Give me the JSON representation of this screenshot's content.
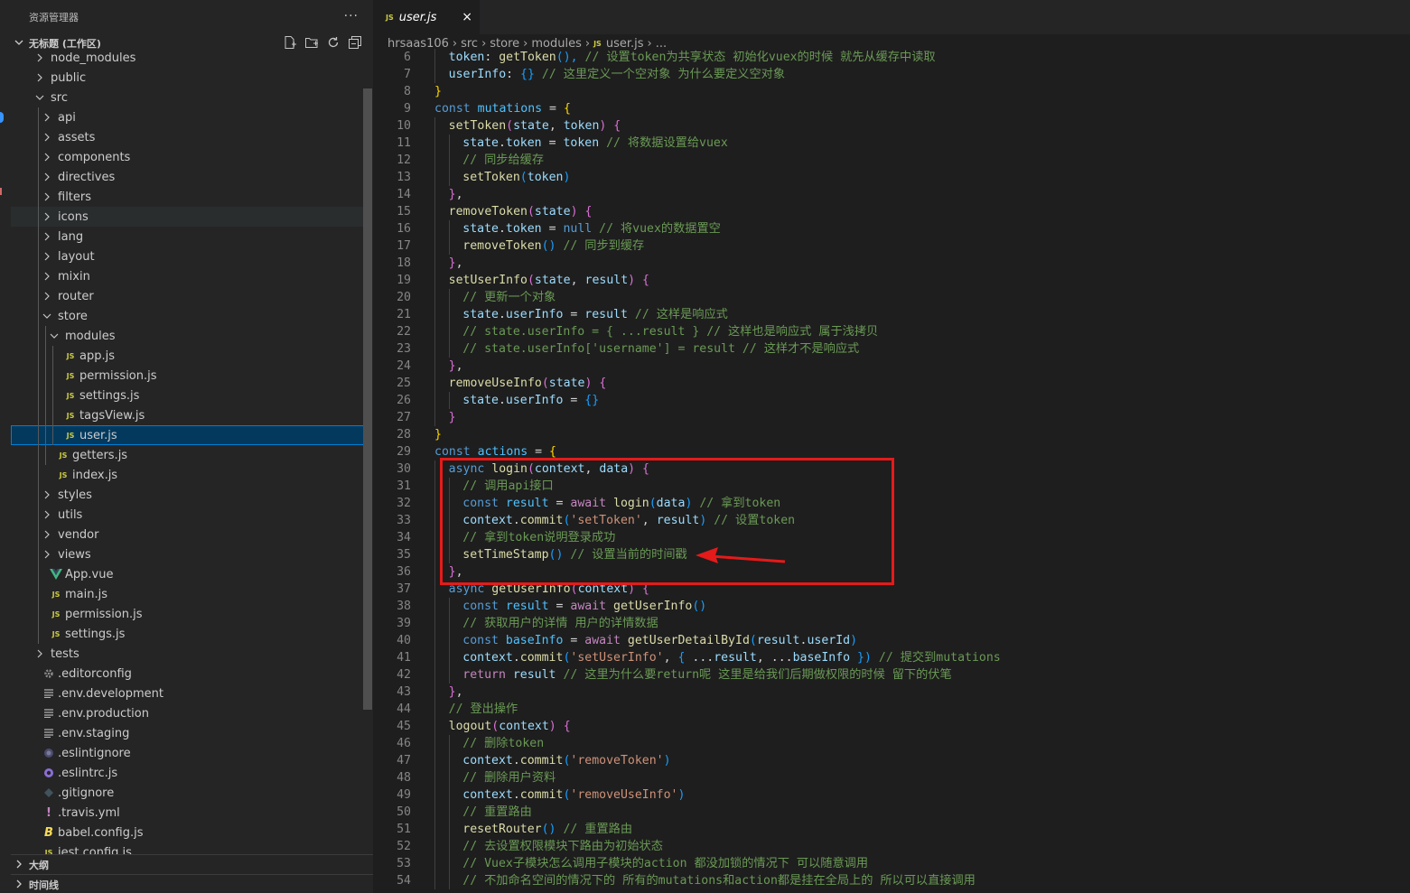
{
  "sidebar": {
    "title": "资源管理器",
    "more": "···",
    "workspace": "无标题 (工作区)",
    "tree": [
      {
        "label": "node_modules",
        "depth": 1,
        "kind": "folder",
        "open": false
      },
      {
        "label": "public",
        "depth": 1,
        "kind": "folder",
        "open": false
      },
      {
        "label": "src",
        "depth": 1,
        "kind": "folder",
        "open": true
      },
      {
        "label": "api",
        "depth": 2,
        "kind": "folder",
        "open": false
      },
      {
        "label": "assets",
        "depth": 2,
        "kind": "folder",
        "open": false
      },
      {
        "label": "components",
        "depth": 2,
        "kind": "folder",
        "open": false
      },
      {
        "label": "directives",
        "depth": 2,
        "kind": "folder",
        "open": false
      },
      {
        "label": "filters",
        "depth": 2,
        "kind": "folder",
        "open": false
      },
      {
        "label": "icons",
        "depth": 2,
        "kind": "folder",
        "open": false,
        "hover": true
      },
      {
        "label": "lang",
        "depth": 2,
        "kind": "folder",
        "open": false
      },
      {
        "label": "layout",
        "depth": 2,
        "kind": "folder",
        "open": false
      },
      {
        "label": "mixin",
        "depth": 2,
        "kind": "folder",
        "open": false
      },
      {
        "label": "router",
        "depth": 2,
        "kind": "folder",
        "open": false
      },
      {
        "label": "store",
        "depth": 2,
        "kind": "folder",
        "open": true
      },
      {
        "label": "modules",
        "depth": 3,
        "kind": "folder",
        "open": true
      },
      {
        "label": "app.js",
        "depth": 4,
        "kind": "js"
      },
      {
        "label": "permission.js",
        "depth": 4,
        "kind": "js"
      },
      {
        "label": "settings.js",
        "depth": 4,
        "kind": "js"
      },
      {
        "label": "tagsView.js",
        "depth": 4,
        "kind": "js"
      },
      {
        "label": "user.js",
        "depth": 4,
        "kind": "js",
        "selected": true
      },
      {
        "label": "getters.js",
        "depth": 3,
        "kind": "js"
      },
      {
        "label": "index.js",
        "depth": 3,
        "kind": "js"
      },
      {
        "label": "styles",
        "depth": 2,
        "kind": "folder",
        "open": false
      },
      {
        "label": "utils",
        "depth": 2,
        "kind": "folder",
        "open": false
      },
      {
        "label": "vendor",
        "depth": 2,
        "kind": "folder",
        "open": false
      },
      {
        "label": "views",
        "depth": 2,
        "kind": "folder",
        "open": false
      },
      {
        "label": "App.vue",
        "depth": 2,
        "kind": "vue"
      },
      {
        "label": "main.js",
        "depth": 2,
        "kind": "js"
      },
      {
        "label": "permission.js",
        "depth": 2,
        "kind": "js"
      },
      {
        "label": "settings.js",
        "depth": 2,
        "kind": "js"
      },
      {
        "label": "tests",
        "depth": 1,
        "kind": "folder",
        "open": false
      },
      {
        "label": ".editorconfig",
        "depth": 1,
        "kind": "gear"
      },
      {
        "label": ".env.development",
        "depth": 1,
        "kind": "lines"
      },
      {
        "label": ".env.production",
        "depth": 1,
        "kind": "lines"
      },
      {
        "label": ".env.staging",
        "depth": 1,
        "kind": "lines"
      },
      {
        "label": ".eslintignore",
        "depth": 1,
        "kind": "circle-grey"
      },
      {
        "label": ".eslintrc.js",
        "depth": 1,
        "kind": "circle-purple"
      },
      {
        "label": ".gitignore",
        "depth": 1,
        "kind": "diamond"
      },
      {
        "label": ".travis.yml",
        "depth": 1,
        "kind": "excl"
      },
      {
        "label": "babel.config.js",
        "depth": 1,
        "kind": "babel"
      },
      {
        "label": "jest.config.js",
        "depth": 1,
        "kind": "js"
      }
    ],
    "panels": [
      "大纲",
      "时间线"
    ]
  },
  "tab": {
    "label": "user.js",
    "close": "×",
    "badge": "JS"
  },
  "breadcrumb": [
    "hrsaas106",
    "src",
    "store",
    "modules",
    "user.js",
    "..."
  ],
  "code": [
    {
      "n": "6",
      "i": 1,
      "t": [
        [
          "token",
          "p"
        ],
        [
          ": ",
          "w"
        ],
        [
          "getToken",
          "f"
        ],
        [
          "(), ",
          "b"
        ],
        [
          "// 设置token为共享状态 初始化vuex的时候 就先从缓存中读取",
          "c"
        ]
      ]
    },
    {
      "n": "7",
      "i": 1,
      "t": [
        [
          "userInfo",
          "p"
        ],
        [
          ": ",
          "w"
        ],
        [
          "{}",
          "b"
        ],
        [
          " ",
          "w"
        ],
        [
          "// 这里定义一个空对象 为什么要定义空对象",
          "c"
        ]
      ]
    },
    {
      "n": "8",
      "i": 0,
      "t": [
        [
          "}",
          "y"
        ]
      ]
    },
    {
      "n": "9",
      "i": 0,
      "t": [
        [
          "const ",
          "k"
        ],
        [
          "mutations",
          "v"
        ],
        [
          " = ",
          "w"
        ],
        [
          "{",
          "y"
        ]
      ]
    },
    {
      "n": "10",
      "i": 1,
      "t": [
        [
          "setToken",
          "f"
        ],
        [
          "(",
          "p2"
        ],
        [
          "state",
          "p"
        ],
        [
          ", ",
          "w"
        ],
        [
          "token",
          "p"
        ],
        [
          ") ",
          "p2"
        ],
        [
          "{",
          "p2"
        ]
      ]
    },
    {
      "n": "11",
      "i": 2,
      "t": [
        [
          "state",
          "p"
        ],
        [
          ".",
          "w"
        ],
        [
          "token",
          "p"
        ],
        [
          " = ",
          "w"
        ],
        [
          "token",
          "p"
        ],
        [
          " ",
          "w"
        ],
        [
          "// 将数据设置给vuex",
          "c"
        ]
      ]
    },
    {
      "n": "12",
      "i": 2,
      "t": [
        [
          "// 同步给缓存",
          "c"
        ]
      ]
    },
    {
      "n": "13",
      "i": 2,
      "t": [
        [
          "setToken",
          "f"
        ],
        [
          "(",
          "b"
        ],
        [
          "token",
          "p"
        ],
        [
          ")",
          "b"
        ]
      ]
    },
    {
      "n": "14",
      "i": 1,
      "t": [
        [
          "}",
          "p2"
        ],
        [
          ",",
          "w"
        ]
      ]
    },
    {
      "n": "15",
      "i": 1,
      "t": [
        [
          "removeToken",
          "f"
        ],
        [
          "(",
          "p2"
        ],
        [
          "state",
          "p"
        ],
        [
          ") ",
          "p2"
        ],
        [
          "{",
          "p2"
        ]
      ]
    },
    {
      "n": "16",
      "i": 2,
      "t": [
        [
          "state",
          "p"
        ],
        [
          ".",
          "w"
        ],
        [
          "token",
          "p"
        ],
        [
          " = ",
          "w"
        ],
        [
          "null",
          "k"
        ],
        [
          " ",
          "w"
        ],
        [
          "// 将vuex的数据置空",
          "c"
        ]
      ]
    },
    {
      "n": "17",
      "i": 2,
      "t": [
        [
          "removeToken",
          "f"
        ],
        [
          "()",
          "b"
        ],
        [
          " ",
          "w"
        ],
        [
          "// 同步到缓存",
          "c"
        ]
      ]
    },
    {
      "n": "18",
      "i": 1,
      "t": [
        [
          "}",
          "p2"
        ],
        [
          ",",
          "w"
        ]
      ]
    },
    {
      "n": "19",
      "i": 1,
      "t": [
        [
          "setUserInfo",
          "f"
        ],
        [
          "(",
          "p2"
        ],
        [
          "state",
          "p"
        ],
        [
          ", ",
          "w"
        ],
        [
          "result",
          "p"
        ],
        [
          ") ",
          "p2"
        ],
        [
          "{",
          "p2"
        ]
      ]
    },
    {
      "n": "20",
      "i": 2,
      "t": [
        [
          "// 更新一个对象",
          "c"
        ]
      ]
    },
    {
      "n": "21",
      "i": 2,
      "t": [
        [
          "state",
          "p"
        ],
        [
          ".",
          "w"
        ],
        [
          "userInfo",
          "p"
        ],
        [
          " = ",
          "w"
        ],
        [
          "result",
          "p"
        ],
        [
          " ",
          "w"
        ],
        [
          "// 这样是响应式",
          "c"
        ]
      ]
    },
    {
      "n": "22",
      "i": 2,
      "t": [
        [
          "// state.userInfo = { ...result } // 这样也是响应式 属于浅拷贝",
          "c"
        ]
      ]
    },
    {
      "n": "23",
      "i": 2,
      "t": [
        [
          "// state.userInfo['username'] = result // 这样才不是响应式",
          "c"
        ]
      ]
    },
    {
      "n": "24",
      "i": 1,
      "t": [
        [
          "}",
          "p2"
        ],
        [
          ",",
          "w"
        ]
      ]
    },
    {
      "n": "25",
      "i": 1,
      "t": [
        [
          "removeUseInfo",
          "f"
        ],
        [
          "(",
          "p2"
        ],
        [
          "state",
          "p"
        ],
        [
          ") ",
          "p2"
        ],
        [
          "{",
          "p2"
        ]
      ]
    },
    {
      "n": "26",
      "i": 2,
      "t": [
        [
          "state",
          "p"
        ],
        [
          ".",
          "w"
        ],
        [
          "userInfo",
          "p"
        ],
        [
          " = ",
          "w"
        ],
        [
          "{}",
          "b"
        ]
      ]
    },
    {
      "n": "27",
      "i": 1,
      "t": [
        [
          "}",
          "p2"
        ]
      ]
    },
    {
      "n": "28",
      "i": 0,
      "t": [
        [
          "}",
          "y"
        ]
      ]
    },
    {
      "n": "29",
      "i": 0,
      "t": [
        [
          "const ",
          "k"
        ],
        [
          "actions",
          "v"
        ],
        [
          " = ",
          "w"
        ],
        [
          "{",
          "y"
        ]
      ]
    },
    {
      "n": "30",
      "i": 1,
      "t": [
        [
          "async ",
          "k"
        ],
        [
          "login",
          "f"
        ],
        [
          "(",
          "p2"
        ],
        [
          "context",
          "p"
        ],
        [
          ", ",
          "w"
        ],
        [
          "data",
          "p"
        ],
        [
          ") ",
          "p2"
        ],
        [
          "{",
          "p2"
        ]
      ]
    },
    {
      "n": "31",
      "i": 2,
      "t": [
        [
          "// 调用api接口",
          "c"
        ]
      ]
    },
    {
      "n": "32",
      "i": 2,
      "t": [
        [
          "const ",
          "k"
        ],
        [
          "result",
          "v"
        ],
        [
          " = ",
          "w"
        ],
        [
          "await ",
          "m"
        ],
        [
          "login",
          "f"
        ],
        [
          "(",
          "b"
        ],
        [
          "data",
          "p"
        ],
        [
          ")",
          "b"
        ],
        [
          " ",
          "w"
        ],
        [
          "// 拿到token",
          "c"
        ]
      ]
    },
    {
      "n": "33",
      "i": 2,
      "t": [
        [
          "context",
          "p"
        ],
        [
          ".",
          "w"
        ],
        [
          "commit",
          "f"
        ],
        [
          "(",
          "b"
        ],
        [
          "'setToken'",
          "s"
        ],
        [
          ", ",
          "w"
        ],
        [
          "result",
          "p"
        ],
        [
          ")",
          "b"
        ],
        [
          " ",
          "w"
        ],
        [
          "// 设置token",
          "c"
        ]
      ]
    },
    {
      "n": "34",
      "i": 2,
      "t": [
        [
          "// 拿到token说明登录成功",
          "c"
        ]
      ]
    },
    {
      "n": "35",
      "i": 2,
      "t": [
        [
          "setTimeStamp",
          "f"
        ],
        [
          "()",
          "b"
        ],
        [
          " ",
          "w"
        ],
        [
          "// 设置当前的时间戳",
          "c"
        ]
      ]
    },
    {
      "n": "36",
      "i": 1,
      "t": [
        [
          "}",
          "p2"
        ],
        [
          ",",
          "w"
        ]
      ]
    },
    {
      "n": "37",
      "i": 1,
      "t": [
        [
          "async ",
          "k"
        ],
        [
          "getUserInfo",
          "f"
        ],
        [
          "(",
          "p2"
        ],
        [
          "context",
          "p"
        ],
        [
          ") ",
          "p2"
        ],
        [
          "{",
          "p2"
        ]
      ]
    },
    {
      "n": "38",
      "i": 2,
      "t": [
        [
          "const ",
          "k"
        ],
        [
          "result",
          "v"
        ],
        [
          " = ",
          "w"
        ],
        [
          "await ",
          "m"
        ],
        [
          "getUserInfo",
          "f"
        ],
        [
          "()",
          "b"
        ]
      ]
    },
    {
      "n": "39",
      "i": 2,
      "t": [
        [
          "// 获取用户的详情 用户的详情数据",
          "c"
        ]
      ]
    },
    {
      "n": "40",
      "i": 2,
      "t": [
        [
          "const ",
          "k"
        ],
        [
          "baseInfo",
          "v"
        ],
        [
          " = ",
          "w"
        ],
        [
          "await ",
          "m"
        ],
        [
          "getUserDetailById",
          "f"
        ],
        [
          "(",
          "b"
        ],
        [
          "result",
          "p"
        ],
        [
          ".",
          "w"
        ],
        [
          "userId",
          "p"
        ],
        [
          ")",
          "b"
        ]
      ]
    },
    {
      "n": "41",
      "i": 2,
      "t": [
        [
          "context",
          "p"
        ],
        [
          ".",
          "w"
        ],
        [
          "commit",
          "f"
        ],
        [
          "(",
          "b"
        ],
        [
          "'setUserInfo'",
          "s"
        ],
        [
          ", ",
          "w"
        ],
        [
          "{ ",
          "b"
        ],
        [
          "...",
          "w"
        ],
        [
          "result",
          "p"
        ],
        [
          ", ",
          "w"
        ],
        [
          "...",
          "w"
        ],
        [
          "baseInfo",
          "p"
        ],
        [
          " })",
          "b"
        ],
        [
          " ",
          "w"
        ],
        [
          "// 提交到mutations",
          "c"
        ]
      ]
    },
    {
      "n": "42",
      "i": 2,
      "t": [
        [
          "return ",
          "m"
        ],
        [
          "result",
          "p"
        ],
        [
          " ",
          "w"
        ],
        [
          "// 这里为什么要return呢 这里是给我们后期做权限的时候 留下的伏笔",
          "c"
        ]
      ]
    },
    {
      "n": "43",
      "i": 1,
      "t": [
        [
          "}",
          "p2"
        ],
        [
          ",",
          "w"
        ]
      ]
    },
    {
      "n": "44",
      "i": 1,
      "t": [
        [
          "// 登出操作",
          "c"
        ]
      ]
    },
    {
      "n": "45",
      "i": 1,
      "t": [
        [
          "logout",
          "f"
        ],
        [
          "(",
          "p2"
        ],
        [
          "context",
          "p"
        ],
        [
          ") ",
          "p2"
        ],
        [
          "{",
          "p2"
        ]
      ]
    },
    {
      "n": "46",
      "i": 2,
      "t": [
        [
          "// 删除token",
          "c"
        ]
      ]
    },
    {
      "n": "47",
      "i": 2,
      "t": [
        [
          "context",
          "p"
        ],
        [
          ".",
          "w"
        ],
        [
          "commit",
          "f"
        ],
        [
          "(",
          "b"
        ],
        [
          "'removeToken'",
          "s"
        ],
        [
          ")",
          "b"
        ]
      ]
    },
    {
      "n": "48",
      "i": 2,
      "t": [
        [
          "// 删除用户资料",
          "c"
        ]
      ]
    },
    {
      "n": "49",
      "i": 2,
      "t": [
        [
          "context",
          "p"
        ],
        [
          ".",
          "w"
        ],
        [
          "commit",
          "f"
        ],
        [
          "(",
          "b"
        ],
        [
          "'removeUseInfo'",
          "s"
        ],
        [
          ")",
          "b"
        ]
      ]
    },
    {
      "n": "50",
      "i": 2,
      "t": [
        [
          "// 重置路由",
          "c"
        ]
      ]
    },
    {
      "n": "51",
      "i": 2,
      "t": [
        [
          "resetRouter",
          "f"
        ],
        [
          "()",
          "b"
        ],
        [
          " ",
          "w"
        ],
        [
          "// 重置路由",
          "c"
        ]
      ]
    },
    {
      "n": "52",
      "i": 2,
      "t": [
        [
          "// 去设置权限模块下路由为初始状态",
          "c"
        ]
      ]
    },
    {
      "n": "53",
      "i": 2,
      "t": [
        [
          "// Vuex子模块怎么调用子模块的action 都没加锁的情况下 可以随意调用",
          "c"
        ]
      ]
    },
    {
      "n": "54",
      "i": 2,
      "t": [
        [
          "// 不加命名空间的情况下的 所有的mutations和action都是挂在全局上的 所以可以直接调用",
          "c"
        ]
      ]
    }
  ],
  "syntax_colors": {
    "k": "#569cd6",
    "v": "#4fc1ff",
    "p": "#9cdcfe",
    "f": "#dcdcaa",
    "c": "#6a9955",
    "s": "#ce9178",
    "m": "#c586c0",
    "w": "#d4d4d4",
    "b": "#179fff",
    "y": "#ffd700",
    "p2": "#da70d6"
  },
  "annotation_color": "#e51a1a"
}
